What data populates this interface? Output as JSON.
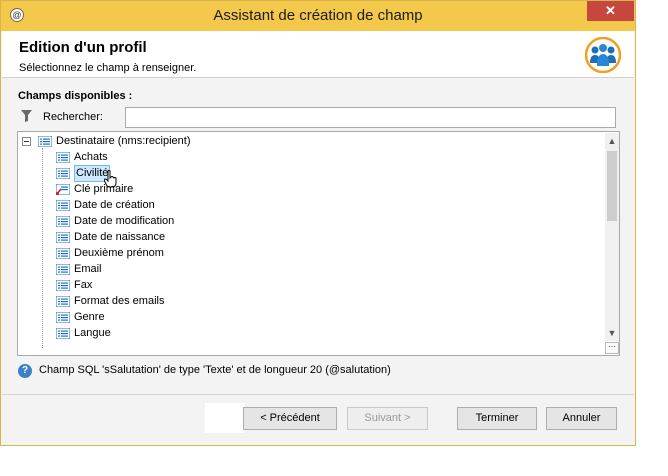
{
  "window": {
    "title": "Assistant de création de champ",
    "close_glyph": "✕"
  },
  "header": {
    "title": "Edition d'un profil",
    "subtitle": "Sélectionnez le champ à renseigner."
  },
  "fields": {
    "section_label": "Champs disponibles :",
    "search_label": "Rechercher:",
    "search_value": ""
  },
  "tree": {
    "root_label": "Destinataire (nms:recipient)",
    "items": [
      {
        "label": "Achats",
        "icon": "list-icon"
      },
      {
        "label": "Civilité",
        "icon": "list-icon",
        "selected": true
      },
      {
        "label": "Clé primaire",
        "icon": "key-list-icon"
      },
      {
        "label": "Date de création",
        "icon": "list-icon"
      },
      {
        "label": "Date de modification",
        "icon": "list-icon"
      },
      {
        "label": "Date de naissance",
        "icon": "list-icon"
      },
      {
        "label": "Deuxième prénom",
        "icon": "list-icon"
      },
      {
        "label": "Email",
        "icon": "list-icon"
      },
      {
        "label": "Fax",
        "icon": "list-icon"
      },
      {
        "label": "Format des emails",
        "icon": "list-icon"
      },
      {
        "label": "Genre",
        "icon": "list-icon"
      },
      {
        "label": "Langue",
        "icon": "list-icon"
      }
    ],
    "corner_glyph": "···"
  },
  "help": {
    "glyph": "?",
    "text": "Champ SQL 'sSalutation' de type 'Texte' et de longueur 20 (@salutation)"
  },
  "buttons": {
    "previous": "< Précédent",
    "next": "Suivant >",
    "finish": "Terminer",
    "cancel": "Annuler"
  },
  "colors": {
    "titlebar": "#f3c84b",
    "close": "#c7463e",
    "selection": "#cde8ff",
    "icon_blue": "#1a73c9"
  }
}
